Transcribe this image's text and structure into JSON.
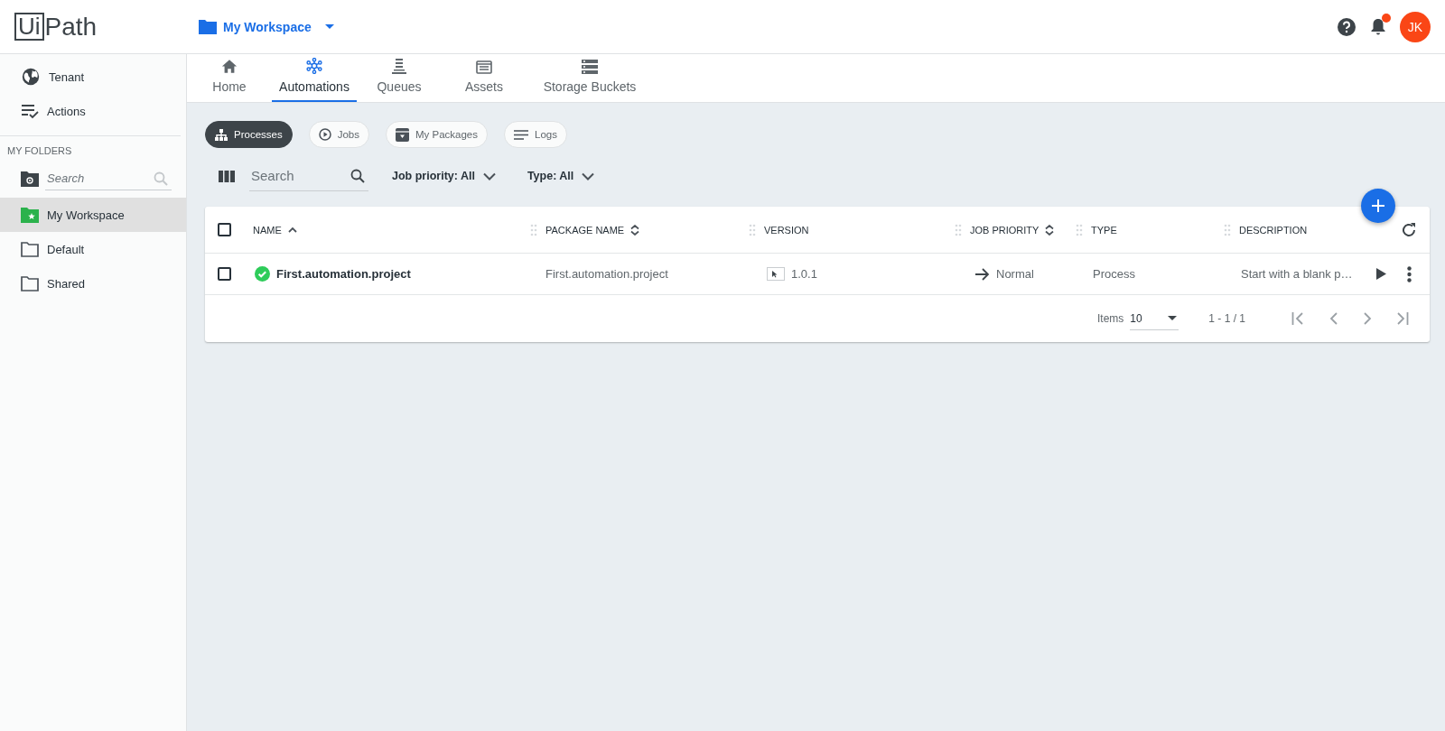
{
  "header": {
    "logo": {
      "boxed": "Ui",
      "text": "Path"
    },
    "folder_picker": "My Workspace",
    "notification": true,
    "avatar": "JK"
  },
  "sidebar": {
    "items": [
      {
        "label": "Tenant",
        "kind": "globe",
        "selected": false
      },
      {
        "label": "Actions",
        "kind": "checklist",
        "selected": false
      }
    ],
    "section_title": "MY FOLDERS",
    "search": {
      "placeholder": "Search"
    },
    "folders": [
      {
        "label": "My Workspace",
        "kind": "workspace",
        "selected": true
      },
      {
        "label": "Default",
        "kind": "folder",
        "selected": false
      },
      {
        "label": "Shared",
        "kind": "folder",
        "selected": false
      }
    ]
  },
  "tabs": [
    {
      "label": "Home",
      "kind": "home",
      "selected": false
    },
    {
      "label": "Automations",
      "kind": "network",
      "selected": true
    },
    {
      "label": "Queues",
      "kind": "queue",
      "selected": false
    },
    {
      "label": "Assets",
      "kind": "asset",
      "selected": false
    },
    {
      "label": "Storage Buckets",
      "kind": "storage",
      "selected": false
    }
  ],
  "chips": [
    {
      "label": "Processes",
      "kind": "hierarchy",
      "selected": true
    },
    {
      "label": "Jobs",
      "kind": "play-circle",
      "selected": false
    },
    {
      "label": "My Packages",
      "kind": "package",
      "selected": false
    },
    {
      "label": "Logs",
      "kind": "lines",
      "selected": false
    }
  ],
  "filters": {
    "search": {
      "placeholder": "Search"
    },
    "dropdowns": [
      {
        "label": "Job priority:",
        "value": "All"
      },
      {
        "label": "Type:",
        "value": "All"
      }
    ]
  },
  "table": {
    "all_selected": false,
    "columns": [
      {
        "label": "NAME",
        "kind": "sorted-asc"
      },
      {
        "label": "PACKAGE NAME",
        "kind": "sortable"
      },
      {
        "label": "VERSION",
        "kind": "plain"
      },
      {
        "label": "JOB PRIORITY",
        "kind": "sortable"
      },
      {
        "label": "TYPE",
        "kind": "plain"
      },
      {
        "label": "DESCRIPTION",
        "kind": "plain"
      }
    ],
    "rows": [
      {
        "selected": false,
        "kind": "success",
        "name": "First.automation.project",
        "package_name": "First.automation.project",
        "version": "1.0.1",
        "job_priority": "Normal",
        "type": "Process",
        "description": "Start with a blank p…"
      }
    ],
    "footer": {
      "items_label": "Items",
      "page_size": "10",
      "range": "1 - 1 / 1"
    }
  }
}
